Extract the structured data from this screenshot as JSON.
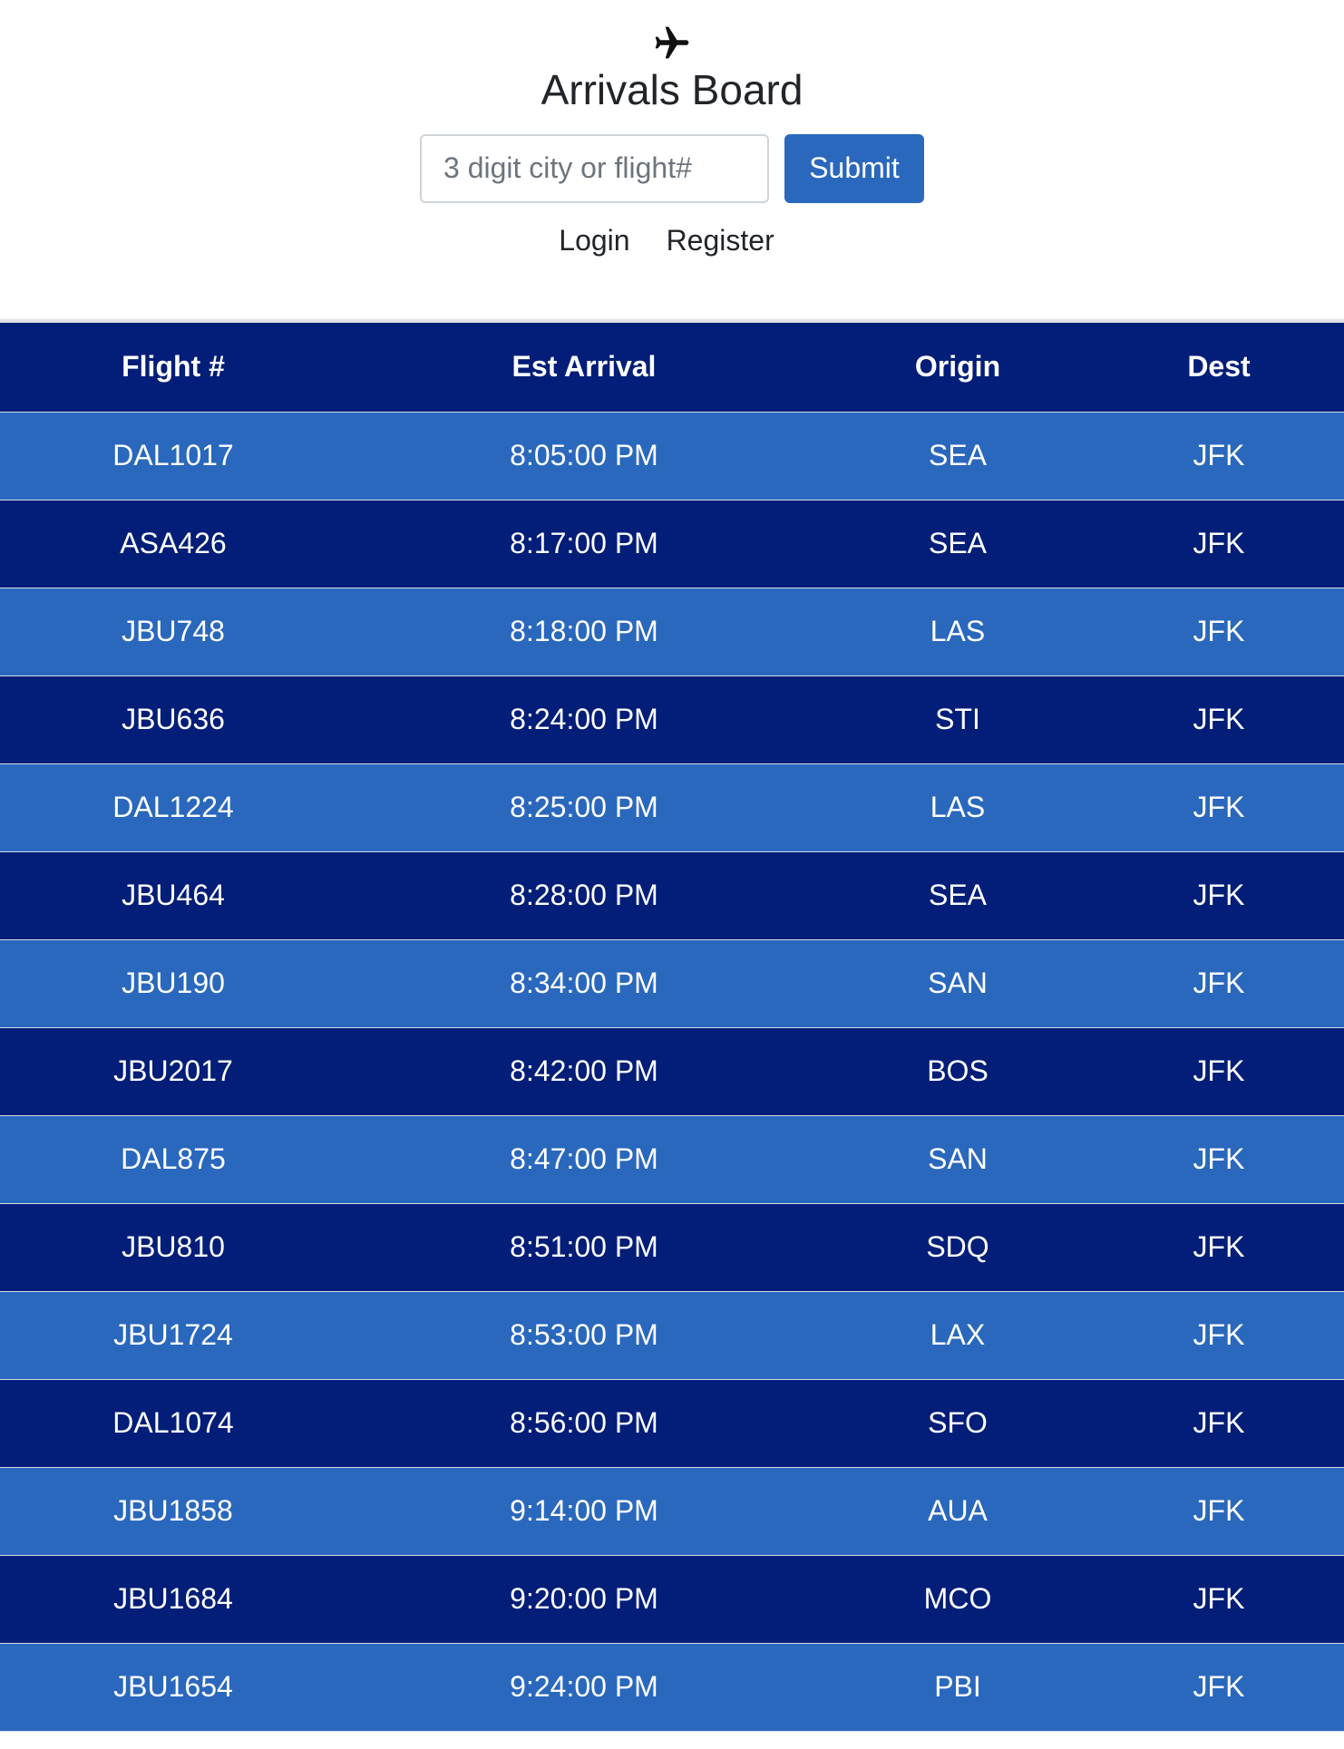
{
  "header": {
    "icon": "airplane-icon",
    "title": "Arrivals Board"
  },
  "search": {
    "placeholder": "3 digit city or flight#",
    "value": "",
    "submit_label": "Submit"
  },
  "nav": {
    "login_label": "Login",
    "register_label": "Register"
  },
  "colors": {
    "dark_row": "#031e78",
    "light_row": "#2a68bd",
    "button": "#2a68bd"
  },
  "table": {
    "columns": [
      "Flight #",
      "Est Arrival",
      "Origin",
      "Dest"
    ],
    "rows": [
      {
        "flight": "DAL1017",
        "arrival": "8:05:00 PM",
        "origin": "SEA",
        "dest": "JFK"
      },
      {
        "flight": "ASA426",
        "arrival": "8:17:00 PM",
        "origin": "SEA",
        "dest": "JFK"
      },
      {
        "flight": "JBU748",
        "arrival": "8:18:00 PM",
        "origin": "LAS",
        "dest": "JFK"
      },
      {
        "flight": "JBU636",
        "arrival": "8:24:00 PM",
        "origin": "STI",
        "dest": "JFK"
      },
      {
        "flight": "DAL1224",
        "arrival": "8:25:00 PM",
        "origin": "LAS",
        "dest": "JFK"
      },
      {
        "flight": "JBU464",
        "arrival": "8:28:00 PM",
        "origin": "SEA",
        "dest": "JFK"
      },
      {
        "flight": "JBU190",
        "arrival": "8:34:00 PM",
        "origin": "SAN",
        "dest": "JFK"
      },
      {
        "flight": "JBU2017",
        "arrival": "8:42:00 PM",
        "origin": "BOS",
        "dest": "JFK"
      },
      {
        "flight": "DAL875",
        "arrival": "8:47:00 PM",
        "origin": "SAN",
        "dest": "JFK"
      },
      {
        "flight": "JBU810",
        "arrival": "8:51:00 PM",
        "origin": "SDQ",
        "dest": "JFK"
      },
      {
        "flight": "JBU1724",
        "arrival": "8:53:00 PM",
        "origin": "LAX",
        "dest": "JFK"
      },
      {
        "flight": "DAL1074",
        "arrival": "8:56:00 PM",
        "origin": "SFO",
        "dest": "JFK"
      },
      {
        "flight": "JBU1858",
        "arrival": "9:14:00 PM",
        "origin": "AUA",
        "dest": "JFK"
      },
      {
        "flight": "JBU1684",
        "arrival": "9:20:00 PM",
        "origin": "MCO",
        "dest": "JFK"
      },
      {
        "flight": "JBU1654",
        "arrival": "9:24:00 PM",
        "origin": "PBI",
        "dest": "JFK"
      }
    ]
  }
}
